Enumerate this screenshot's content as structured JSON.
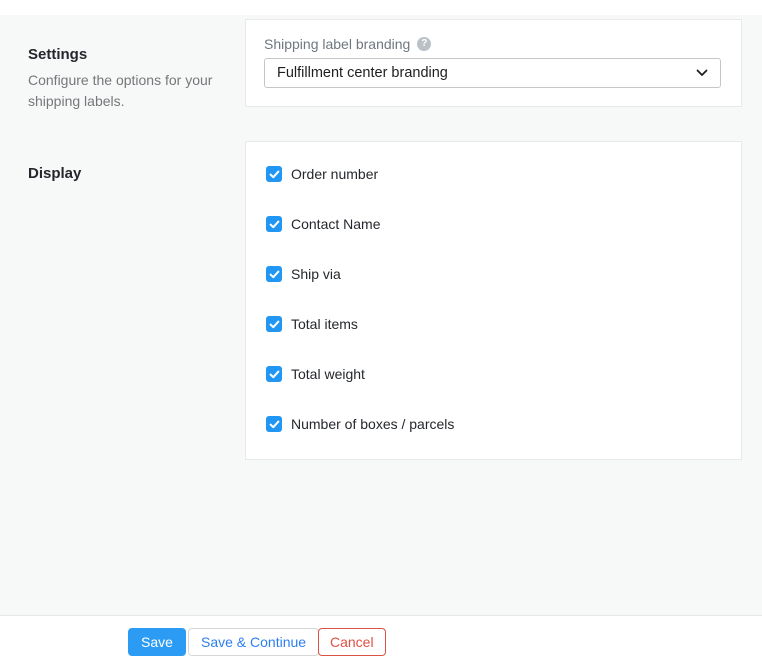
{
  "sidebar": {
    "settings_heading": "Settings",
    "settings_description": "Configure the options for your shipping labels.",
    "display_heading": "Display"
  },
  "branding_card": {
    "label": "Shipping label branding",
    "help_icon": "question-mark-circle-icon",
    "help_glyph": "?",
    "select_value": "Fulfillment center branding",
    "chevron_icon": "chevron-down-icon"
  },
  "display_card": {
    "checkboxes": [
      {
        "label": "Order number",
        "checked": true
      },
      {
        "label": "Contact Name",
        "checked": true
      },
      {
        "label": "Ship via",
        "checked": true
      },
      {
        "label": "Total items",
        "checked": true
      },
      {
        "label": "Total weight",
        "checked": true
      },
      {
        "label": "Number of boxes / parcels",
        "checked": true
      }
    ]
  },
  "footer": {
    "save_label": "Save",
    "save_continue_label": "Save & Continue",
    "cancel_label": "Cancel"
  },
  "colors": {
    "accent_blue": "#2b9bf4",
    "checkbox_blue": "#2196f3",
    "link_blue": "#2d7ff0",
    "cancel_red": "#dd5244",
    "page_background": "#f7f8f8",
    "card_border": "#e9e9e9"
  }
}
